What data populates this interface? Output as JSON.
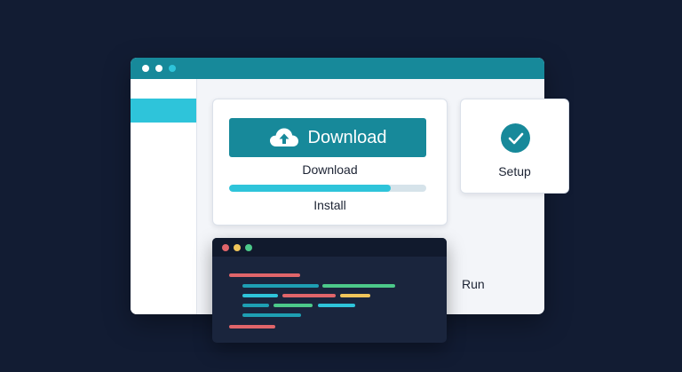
{
  "colors": {
    "background": "#121c33",
    "accent": "#17899a",
    "accent_light": "#2ec4da",
    "window_bg": "#f3f5f9",
    "terminal_bg": "#1a253d",
    "code_red": "#e0656a",
    "code_blue": "#2ec4da",
    "code_teal": "#1e9fb3",
    "code_green": "#4cc98a",
    "code_yellow": "#f0c55a"
  },
  "window": {
    "titlebar_dots": [
      "dot-white",
      "dot-white",
      "dot-teal"
    ]
  },
  "download_card": {
    "button_label": "Download",
    "button_icon": "cloud-upload-icon",
    "step_label": "Download",
    "progress_percent": 82,
    "install_label": "Install"
  },
  "setup_card": {
    "icon": "check-circle-icon",
    "label": "Setup"
  },
  "terminal": {
    "dots": [
      "red",
      "yellow",
      "green"
    ]
  },
  "run_label": "Run"
}
